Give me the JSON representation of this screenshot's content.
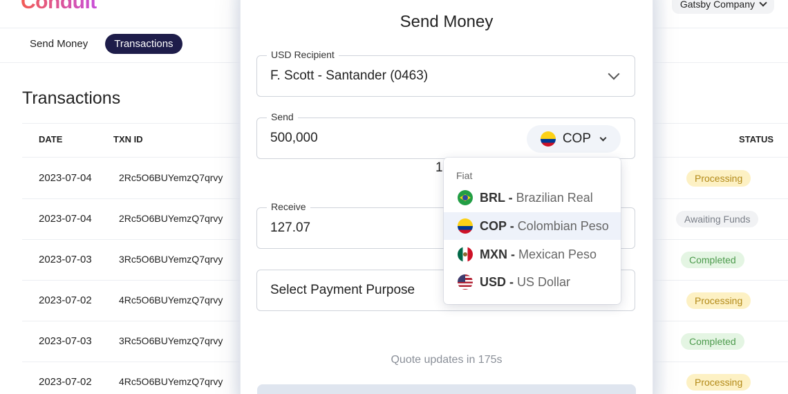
{
  "app": {
    "logo_text": "Conduit",
    "company": "Gatsby Company"
  },
  "tabs": [
    {
      "label": "Send Money"
    },
    {
      "label": "Transactions"
    }
  ],
  "page_title": "Transactions",
  "table": {
    "columns": [
      "DATE",
      "TXN ID",
      "STATUS"
    ],
    "rows": [
      {
        "date": "2023-07-04",
        "txn": "2Rc5O6BUYemzQ7qrvy",
        "status": "Processing"
      },
      {
        "date": "2023-07-04",
        "txn": "2Rc5O6BUYemzQ7qrvy",
        "status": "Awaiting Funds"
      },
      {
        "date": "2023-07-03",
        "txn": "3Rc5O6BUYemzQ7qrvy",
        "status": "Completed"
      },
      {
        "date": "2023-07-02",
        "txn": "4Rc5O6BUYemzQ7qrvy",
        "status": "Processing"
      },
      {
        "date": "2023-07-03",
        "txn": "3Rc5O6BUYemzQ7qrvy",
        "status": "Completed"
      },
      {
        "date": "2023-07-02",
        "txn": "4Rc5O6BUYemzQ7qrvy",
        "status": "Processing"
      }
    ]
  },
  "modal": {
    "title": "Send Money",
    "recipient": {
      "label": "USD Recipient",
      "value": "F. Scott - Santander (0463)"
    },
    "send": {
      "label": "Send",
      "value": "500,000",
      "currency": "COP"
    },
    "rate_partial": "1",
    "receive": {
      "label": "Receive",
      "value": "127.07"
    },
    "purpose": {
      "value": "Select Payment Purpose"
    },
    "quote": "Quote updates in 175s"
  },
  "currency_dropdown": {
    "group": "Fiat",
    "options": [
      {
        "code": "BRL",
        "sep": " - ",
        "name": "Brazilian Real",
        "flag": "br",
        "selected": false
      },
      {
        "code": "COP",
        "sep": " - ",
        "name": "Colombian Peso",
        "flag": "co",
        "selected": true
      },
      {
        "code": "MXN",
        "sep": " - ",
        "name": "Mexican Peso",
        "flag": "mx",
        "selected": false
      },
      {
        "code": "USD",
        "sep": " - ",
        "name": "US Dollar",
        "flag": "us",
        "selected": false
      }
    ]
  },
  "colors": {
    "active_tab": "#1e1d4a",
    "processing": "#fdf1c4",
    "awaiting": "#f1f2f4",
    "completed": "#e4f5e3"
  }
}
